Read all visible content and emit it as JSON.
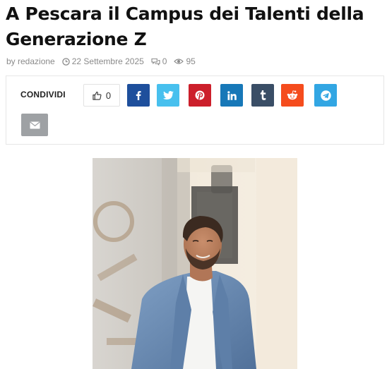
{
  "article": {
    "title": "A Pescara il Campus dei Talenti della Generazione Z"
  },
  "meta": {
    "author_label": "by redazione",
    "date": "22 Settembre 2025",
    "comments": "0",
    "views": "95"
  },
  "share": {
    "label": "CONDIVIDI",
    "like_count": "0",
    "buttons": [
      {
        "network": "facebook",
        "icon": "facebook-icon",
        "color": "#1e4f9c"
      },
      {
        "network": "twitter",
        "icon": "twitter-icon",
        "color": "#48c0ee"
      },
      {
        "network": "pinterest",
        "icon": "pinterest-icon",
        "color": "#cc1f2b"
      },
      {
        "network": "linkedin",
        "icon": "linkedin-icon",
        "color": "#1778b8"
      },
      {
        "network": "tumblr",
        "icon": "tumblr-icon",
        "color": "#3a4e66"
      },
      {
        "network": "reddit",
        "icon": "reddit-icon",
        "color": "#f54c1d"
      },
      {
        "network": "telegram",
        "icon": "telegram-icon",
        "color": "#32a6e3"
      },
      {
        "network": "email",
        "icon": "envelope-icon",
        "color": "#9ea1a4"
      }
    ]
  },
  "photo": {
    "subject": "portrait of a smiling man in a blue blazer and white shirt"
  }
}
